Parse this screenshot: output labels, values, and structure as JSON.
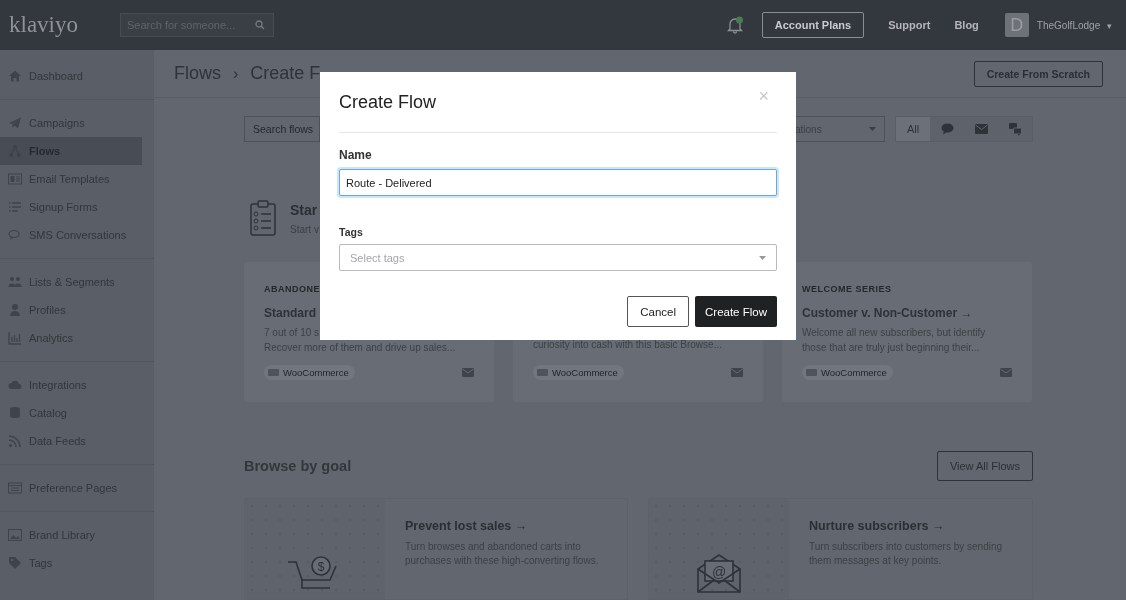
{
  "topbar": {
    "logo": "klaviyo",
    "search_placeholder": "Search for someone...",
    "account_plans": "Account Plans",
    "links": [
      "Support",
      "Blog"
    ],
    "avatar": "D",
    "user": "TheGolfLodge",
    "user_caret": "▾"
  },
  "sidebar": {
    "groups": [
      [
        {
          "label": "Dashboard",
          "selected": false
        }
      ],
      [
        {
          "label": "Campaigns",
          "selected": false
        },
        {
          "label": "Flows",
          "selected": true
        },
        {
          "label": "Email Templates",
          "selected": false
        },
        {
          "label": "Signup Forms",
          "selected": false
        },
        {
          "label": "SMS Conversations",
          "selected": false
        }
      ],
      [
        {
          "label": "Lists & Segments",
          "selected": false
        },
        {
          "label": "Profiles",
          "selected": false
        },
        {
          "label": "Analytics",
          "selected": false
        }
      ],
      [
        {
          "label": "Integrations",
          "selected": false
        },
        {
          "label": "Catalog",
          "selected": false
        },
        {
          "label": "Data Feeds",
          "selected": false
        }
      ],
      [
        {
          "label": "Preference Pages",
          "selected": false
        }
      ],
      [
        {
          "label": "Brand Library",
          "selected": false
        },
        {
          "label": "Tags",
          "selected": false
        }
      ]
    ]
  },
  "breadcrumb": [
    "Flows",
    "Create F"
  ],
  "breadcrumb_separator": "›",
  "create_from_scratch": "Create From Scratch",
  "filters": {
    "search_placeholder": "Search flows",
    "dropdown": "ations",
    "segments": [
      {
        "kind": "text",
        "label": "All",
        "selected": true
      },
      {
        "kind": "chat",
        "selected": false
      },
      {
        "kind": "mail",
        "selected": false
      },
      {
        "kind": "sms",
        "selected": false
      }
    ]
  },
  "start": {
    "title": "Star",
    "subtitle": "Start v"
  },
  "cards": [
    {
      "category": "ABANDONE",
      "title": "Standard",
      "lines": [
        "7 out of 10 s",
        "Recover more of them and drive up sales..."
      ],
      "tag": "WooCommerce"
    },
    {
      "lines": [
        "curiosity into cash with this basic Browse..."
      ],
      "tag": "WooCommerce"
    },
    {
      "category": "WELCOME SERIES",
      "title": "Customer v. Non-Customer →",
      "lines": [
        "Welcome all new subscribers, but identify",
        "those that are truly just beginning their..."
      ],
      "tag": "WooCommerce"
    }
  ],
  "browse": {
    "title": "Browse by goal",
    "button": "View All Flows",
    "goals": [
      {
        "kind": "cart",
        "symbol": "$",
        "title": "Prevent lost sales →",
        "description": "Turn browses and abandoned carts into purchases with these high-converting flows."
      },
      {
        "kind": "envelope",
        "symbol": "@",
        "title": "Nurture subscribers →",
        "description": "Turn subscribers into customers by sending them messages at key points."
      }
    ]
  },
  "modal": {
    "title": "Create Flow",
    "close": "×",
    "name_label": "Name",
    "name_value": "Route - Delivered",
    "tags_label": "Tags",
    "tags_placeholder": "Select tags",
    "cancel": "Cancel",
    "submit": "Create Flow"
  }
}
